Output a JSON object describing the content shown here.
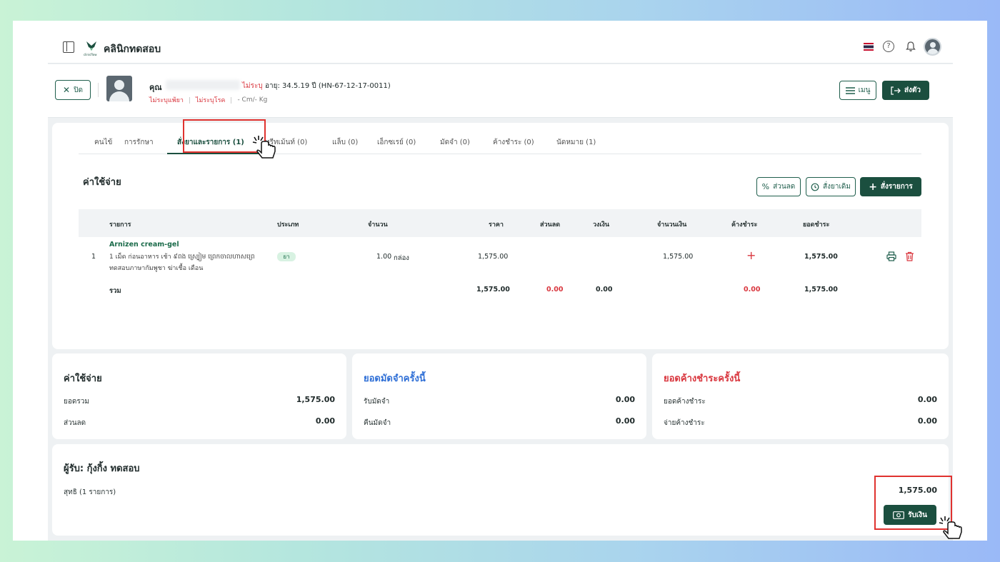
{
  "header": {
    "app_name": "คลินิกทดสอบ",
    "logo_caption": "clinicflow",
    "help_glyph": "?"
  },
  "patient": {
    "prefix": "คุณ",
    "gender": "ไม่ระบุ",
    "age_hn": "อายุ: 34.5.19 ปี  (HN-67-12-17-0011)",
    "allergy": "ไม่ระบุแพ้ยา",
    "disease": "ไม่ระบุโรค",
    "body": "- Cm/- Kg",
    "close_label": "ปิด",
    "menu_label": "เมนู",
    "send_label": "ส่งตัว"
  },
  "tabs": [
    {
      "label": "คนไข้"
    },
    {
      "label": "การรักษา"
    },
    {
      "label": "สั่งยาและรายการ (1)"
    },
    {
      "label": "ทรีทเม้นท์ (0)"
    },
    {
      "label": "แล็บ (0)"
    },
    {
      "label": "เอ็กซเรย์ (0)"
    },
    {
      "label": "มัดจำ (0)"
    },
    {
      "label": "ค้างชำระ (0)"
    },
    {
      "label": "นัดหมาย (1)"
    }
  ],
  "expenses": {
    "title": "ค่าใช้จ่าย",
    "discount_label": "ส่วนลด",
    "reorder_label": "สั่งยาเดิม",
    "order_label": "สั่งรายการ"
  },
  "table": {
    "headers": [
      "รายการ",
      "ประเภท",
      "จำนวน",
      "ราคา",
      "ส่วนลด",
      "วงเงิน",
      "จำนวนเงิน",
      "ค้างชำระ",
      "ยอดชำระ"
    ],
    "row": {
      "no": "1",
      "name": "Arnizen cream-gel",
      "desc": "1 เม็ด ก่อนอาหาร เช้า ៩ពង ស្ប្រៀម ព្រេកចាលហាសព្រេ ทดสอบภาษากัมพูชา ฆ่าเชื้อ เดือน",
      "type": "ยา",
      "qty": "1.00",
      "unit": "กล่อง",
      "price": "1,575.00",
      "amount": "1,575.00",
      "outstanding": "+",
      "paid": "1,575.00"
    },
    "total": {
      "label": "รวม",
      "price": "1,575.00",
      "discount": "0.00",
      "credit": "0.00",
      "outstanding": "0.00",
      "paid": "1,575.00"
    }
  },
  "summary": {
    "expenses": {
      "title": "ค่าใช้จ่าย",
      "r1_label": "ยอดรวม",
      "r1_value": "1,575.00",
      "r2_label": "ส่วนลด",
      "r2_value": "0.00"
    },
    "deposit": {
      "title": "ยอดมัดจำครั้งนี้",
      "r1_label": "รับมัดจำ",
      "r1_value": "0.00",
      "r2_label": "คืนมัดจำ",
      "r2_value": "0.00"
    },
    "outstanding": {
      "title": "ยอดค้างชำระครั้งนี้",
      "r1_label": "ยอดค้างชำระ",
      "r1_value": "0.00",
      "r2_label": "จ่ายค้างชำระ",
      "r2_value": "0.00"
    }
  },
  "payment": {
    "receiver": "ผู้รับ: กุ้งกิ้ง ทดสอบ",
    "net_label": "สุทธิ (1 รายการ)",
    "net_amount": "1,575.00",
    "pay_label": "รับเงิน"
  },
  "colors": {
    "brand": "#1b4f3f",
    "deposit_title": "#2f6fd6",
    "outstanding_title": "#d9363e",
    "highlight": "#e0322f"
  }
}
